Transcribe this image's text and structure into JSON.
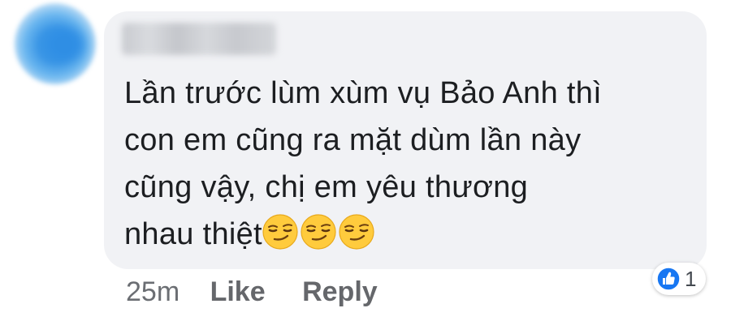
{
  "comment": {
    "author_name": "",
    "text_lines": [
      "Lần trước lùm xùm vụ Bảo Anh thì",
      "con em cũng ra mặt dùm lần này",
      "cũng vậy, chị em yêu thương",
      "nhau thiệt"
    ],
    "emojis": [
      "smirking-face-emoji",
      "smirking-face-emoji",
      "smirking-face-emoji"
    ],
    "bubble_color": "#f1f2f5",
    "text_color": "#1c1e21"
  },
  "actions": {
    "timestamp": "25m",
    "like_label": "Like",
    "reply_label": "Reply",
    "color": "#65676b"
  },
  "reactions": {
    "icon": "like-thumbs-up-icon",
    "icon_color": "#1877f2",
    "count": "1"
  },
  "avatar": {
    "icon": "blurred-avatar",
    "color": "#3a96e6"
  }
}
